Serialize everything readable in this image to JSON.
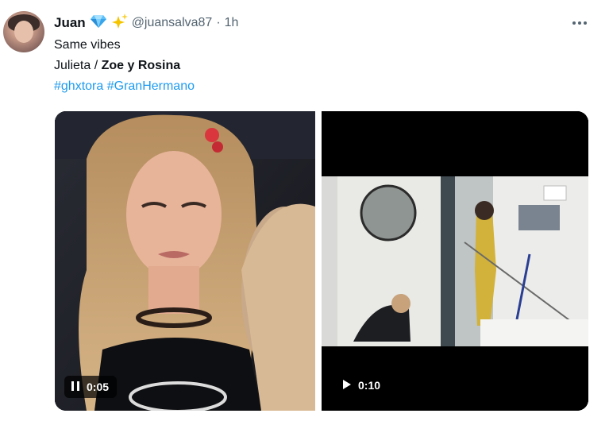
{
  "tweet": {
    "display_name": "Juan",
    "handle": "@juansalva87",
    "separator": "·",
    "time": "1h",
    "lines": {
      "line1": "Same vibes",
      "line2_prefix": "Julieta / ",
      "line2_bold": "Zoe y Rosina"
    },
    "hashtags": [
      "#ghxtora",
      "#GranHermano"
    ],
    "icons": {
      "gem": "gem-icon",
      "sparkles": "sparkles-icon",
      "more": "more-icon",
      "pause": "pause-icon",
      "play": "play-icon"
    }
  },
  "media": {
    "left_video": {
      "time": "0:05",
      "state": "playing"
    },
    "right_video": {
      "time": "0:10",
      "state": "paused"
    }
  },
  "colors": {
    "link": "#1d9bf0",
    "secondary_text": "#536471",
    "gem": "#4fb3f6",
    "sparkle": "#f5c400"
  }
}
